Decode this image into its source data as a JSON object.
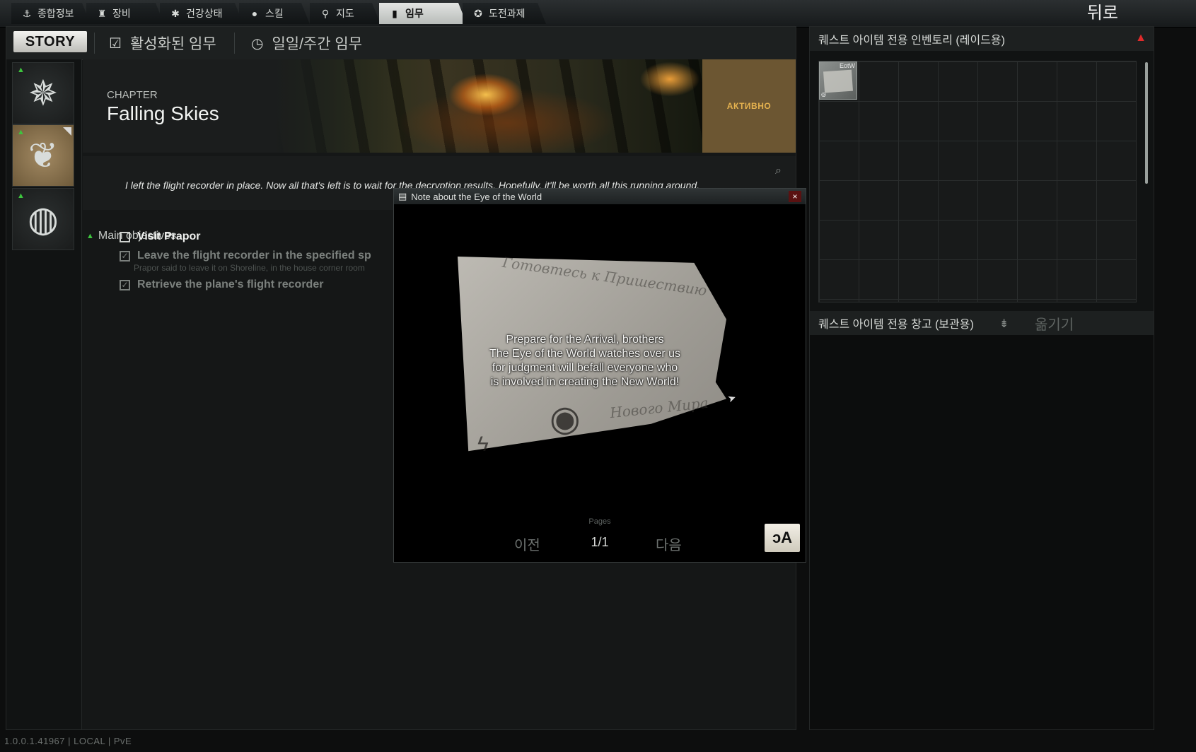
{
  "nav": {
    "tabs": [
      {
        "label": "종합정보",
        "icon": "person-icon"
      },
      {
        "label": "장비",
        "icon": "gear-armor-icon"
      },
      {
        "label": "건강상태",
        "icon": "health-icon"
      },
      {
        "label": "스킬",
        "icon": "skill-icon"
      },
      {
        "label": "지도",
        "icon": "map-pin-icon"
      },
      {
        "label": "임무",
        "icon": "task-icon"
      },
      {
        "label": "도전과제",
        "icon": "achievement-icon"
      }
    ],
    "active_tab": "임무",
    "back_label": "뒤로"
  },
  "quest_tabs": {
    "story_label": "STORY",
    "active_label": "활성화된 임무",
    "daily_label": "일일/주간 임무"
  },
  "chapter": {
    "kicker": "CHAPTER",
    "title": "Falling Skies",
    "status": "АКТИВНО",
    "description": "I left the flight recorder in place. Now all that's left is to wait for the decryption results. Hopefully, it'll be worth all this running around."
  },
  "objectives": {
    "header": "Main objectives",
    "items": [
      {
        "label": "Visit Prapor",
        "done": false
      },
      {
        "label": "Leave the flight recorder in the specified sp",
        "done": true,
        "note": "Prapor said to leave it on Shoreline, in the house corner room"
      },
      {
        "label": "Retrieve the plane's flight recorder",
        "done": true
      }
    ]
  },
  "note_window": {
    "title": "Note about the Eye of the World",
    "close_label": "×",
    "paper_scribble_1": "Готовтесь к Пришествию",
    "paper_scribble_2": "Нового Мира",
    "text_lines": [
      "Prepare for the Arrival, brothers",
      "The Eye of the World watches over us",
      "for judgment will befall everyone who",
      "is involved in creating the New World!"
    ],
    "pages_label": "Pages",
    "page_count": "1/1",
    "prev_label": "이전",
    "next_label": "다음",
    "translate_label": "ᴐA"
  },
  "inventory": {
    "raid_header": "퀘스트 아이템 전용 인벤토리 (레이드용)",
    "item_label": "EotW",
    "stash_header": "퀘스트 아이템 전용 창고 (보관용)",
    "transfer_label": "옮기기"
  },
  "footer": {
    "version": "1.0.0.1.41967 | LOCAL | PvE"
  },
  "colors": {
    "accent_gold": "#e5b24f",
    "status_bg": "#6c5632",
    "alert_green": "#3ec43e",
    "alert_red": "#e02b2b"
  }
}
